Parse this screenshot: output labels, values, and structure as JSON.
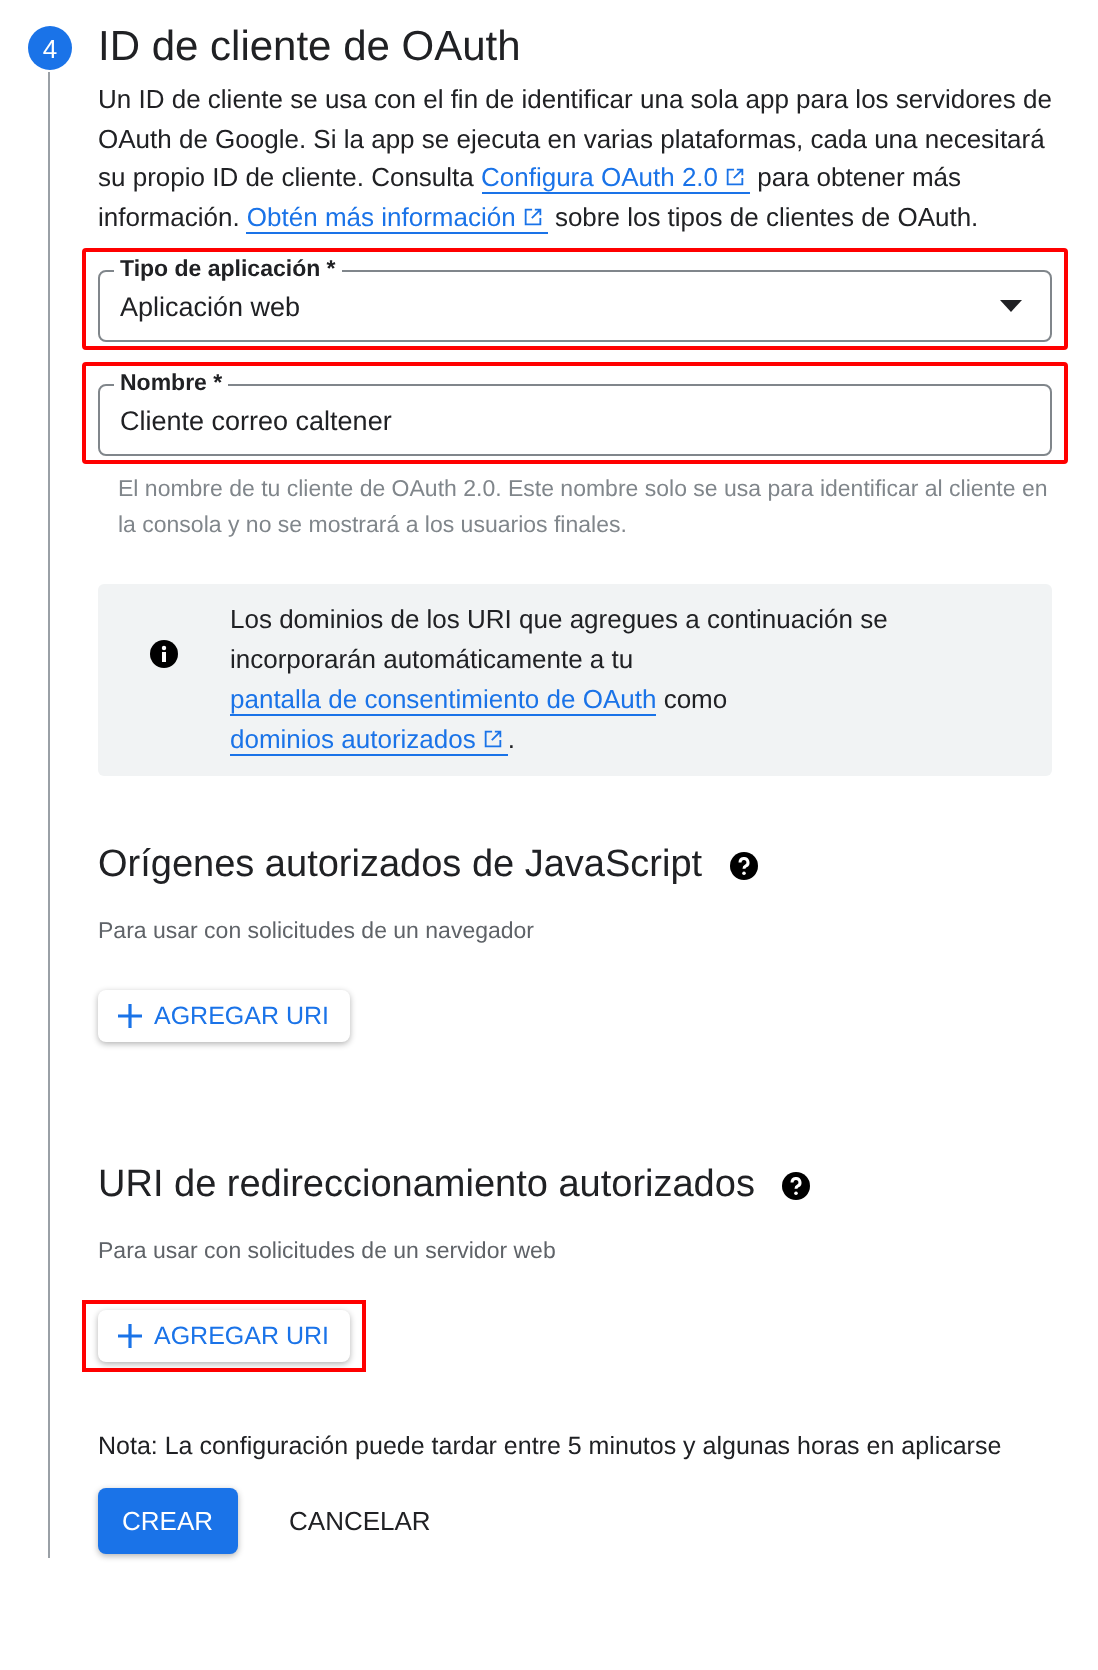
{
  "step": {
    "number": "4",
    "title": "ID de cliente de OAuth"
  },
  "intro": [
    {
      "kind": "text",
      "text": "Un ID de cliente se usa con el fin de identificar una sola app para los servidores de OAuth de Google. Si la app se ejecuta en varias plataformas, cada una necesitará su propio ID de cliente. Consulta "
    },
    {
      "kind": "link",
      "text": "Configura OAuth 2.0",
      "external": true
    },
    {
      "kind": "text",
      "text": " para obtener más información. "
    },
    {
      "kind": "link",
      "text": "Obtén más información",
      "external": true
    },
    {
      "kind": "text",
      "text": " sobre los tipos de clientes de OAuth."
    }
  ],
  "fields": [
    {
      "kind": "select",
      "label": "Tipo de aplicación *",
      "value": "Aplicación web",
      "highlighted": true
    },
    {
      "kind": "text",
      "label": "Nombre *",
      "value": "Cliente correo caltener",
      "highlighted": true,
      "helper": "El nombre de tu cliente de OAuth 2.0. Este nombre solo se usa para identificar al cliente en la consola y no se mostrará a los usuarios finales."
    }
  ],
  "info": [
    {
      "kind": "text",
      "text": "Los dominios de los URI que agregues a continuación se incorporarán automáticamente a tu "
    },
    {
      "kind": "link",
      "text": "pantalla de consentimiento de OAuth",
      "external": false
    },
    {
      "kind": "text",
      "text": " como "
    },
    {
      "kind": "link",
      "text": "dominios autorizados",
      "external": true
    },
    {
      "kind": "text",
      "text": "."
    }
  ],
  "sections": [
    {
      "title": "Orígenes autorizados de JavaScript",
      "subtitle": "Para usar con solicitudes de un navegador",
      "button": "AGREGAR URI",
      "highlighted": false
    },
    {
      "title": "URI de redireccionamiento autorizados",
      "subtitle": "Para usar con solicitudes de un servidor web",
      "button": "AGREGAR URI",
      "highlighted": true
    }
  ],
  "note": "Nota: La configuración puede tardar entre 5 minutos y algunas horas en aplicarse",
  "actions": [
    {
      "kind": "primary",
      "label": "CREAR"
    },
    {
      "kind": "text",
      "label": "CANCELAR"
    }
  ]
}
